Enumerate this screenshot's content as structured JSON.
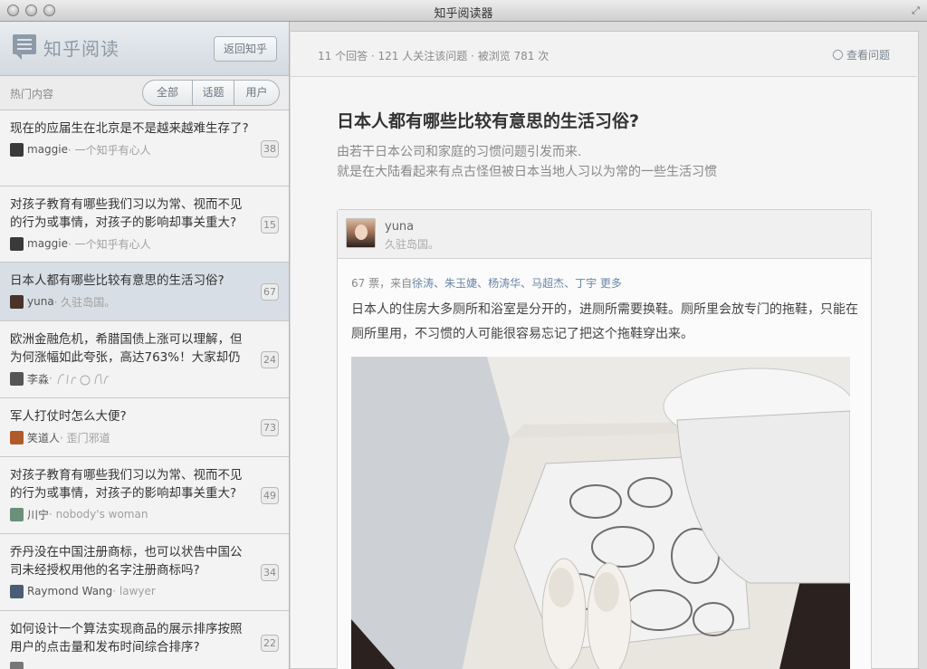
{
  "window": {
    "title": "知乎阅读器"
  },
  "sidebar": {
    "brand": "知乎阅读",
    "back_button": "返回知乎",
    "filter_label": "热门内容",
    "tabs": [
      {
        "label": "全部"
      },
      {
        "label": "话题"
      },
      {
        "label": "用户"
      }
    ],
    "items": [
      {
        "title": "现在的应届生在北京是不是越来越难生存了?",
        "author": "maggie",
        "bio": "· 一个知乎有心人",
        "count": "38",
        "avatar_color": "#3a3a3a"
      },
      {
        "title": "对孩子教育有哪些我们习以为常、视而不见的行为或事情，对孩子的影响却事关重大?",
        "author": "maggie",
        "bio": "· 一个知乎有心人",
        "count": "15",
        "avatar_color": "#3a3a3a"
      },
      {
        "title": "日本人都有哪些比较有意思的生活习俗?",
        "author": "yuna",
        "bio": "· 久驻岛国。",
        "count": "67",
        "avatar_color": "#4a3328",
        "selected": true
      },
      {
        "title": "欧洲金融危机，希腊国债上涨可以理解，但为何涨幅如此夸张，高达763%！大家却仍",
        "author": "李淼",
        "bio": "·",
        "count": "24",
        "avatar_color": "#555555"
      },
      {
        "title": "军人打仗时怎么大便?",
        "author": "笑道人",
        "bio": "· 歪门邪道",
        "count": "73",
        "avatar_color": "#b05a2a"
      },
      {
        "title": "对孩子教育有哪些我们习以为常、视而不见的行为或事情，对孩子的影响却事关重大?",
        "author": "川宁",
        "bio": "· nobody's woman",
        "count": "49",
        "avatar_color": "#6b8f7a"
      },
      {
        "title": "乔丹没在中国注册商标，也可以状告中国公司未经授权用他的名字注册商标吗?",
        "author": "Raymond Wang",
        "bio": "· lawyer",
        "count": "34",
        "avatar_color": "#4b5d74"
      },
      {
        "title": "如何设计一个算法实现商品的展示排序按照用户的点击量和发布时间综合排序?",
        "author": "",
        "bio": "",
        "count": "22",
        "avatar_color": "#777777"
      }
    ]
  },
  "question": {
    "stats": "11 个回答 ·  121 人关注该问题 ·  被浏览 781 次",
    "view_link": "查看问题",
    "title": "日本人都有哪些比较有意思的生活习俗?",
    "desc_line1": "由若干日本公司和家庭的习惯问题引发而来.",
    "desc_line2": "就是在大陆看起来有点古怪但被日本当地人习以为常的一些生活习惯"
  },
  "answer": {
    "author": "yuna",
    "tagline": "久驻岛国。",
    "votes_prefix": "67 票，来自",
    "votes_names": "徐涛、朱玉婕、杨涛华、马超杰、丁宇 更多",
    "text": "日本人的住房大多厕所和浴室是分开的，进厕所需要换鞋。厕所里会放专门的拖鞋，只能在厕所里用，不习惯的人可能很容易忘记了把这个拖鞋穿出来。"
  }
}
